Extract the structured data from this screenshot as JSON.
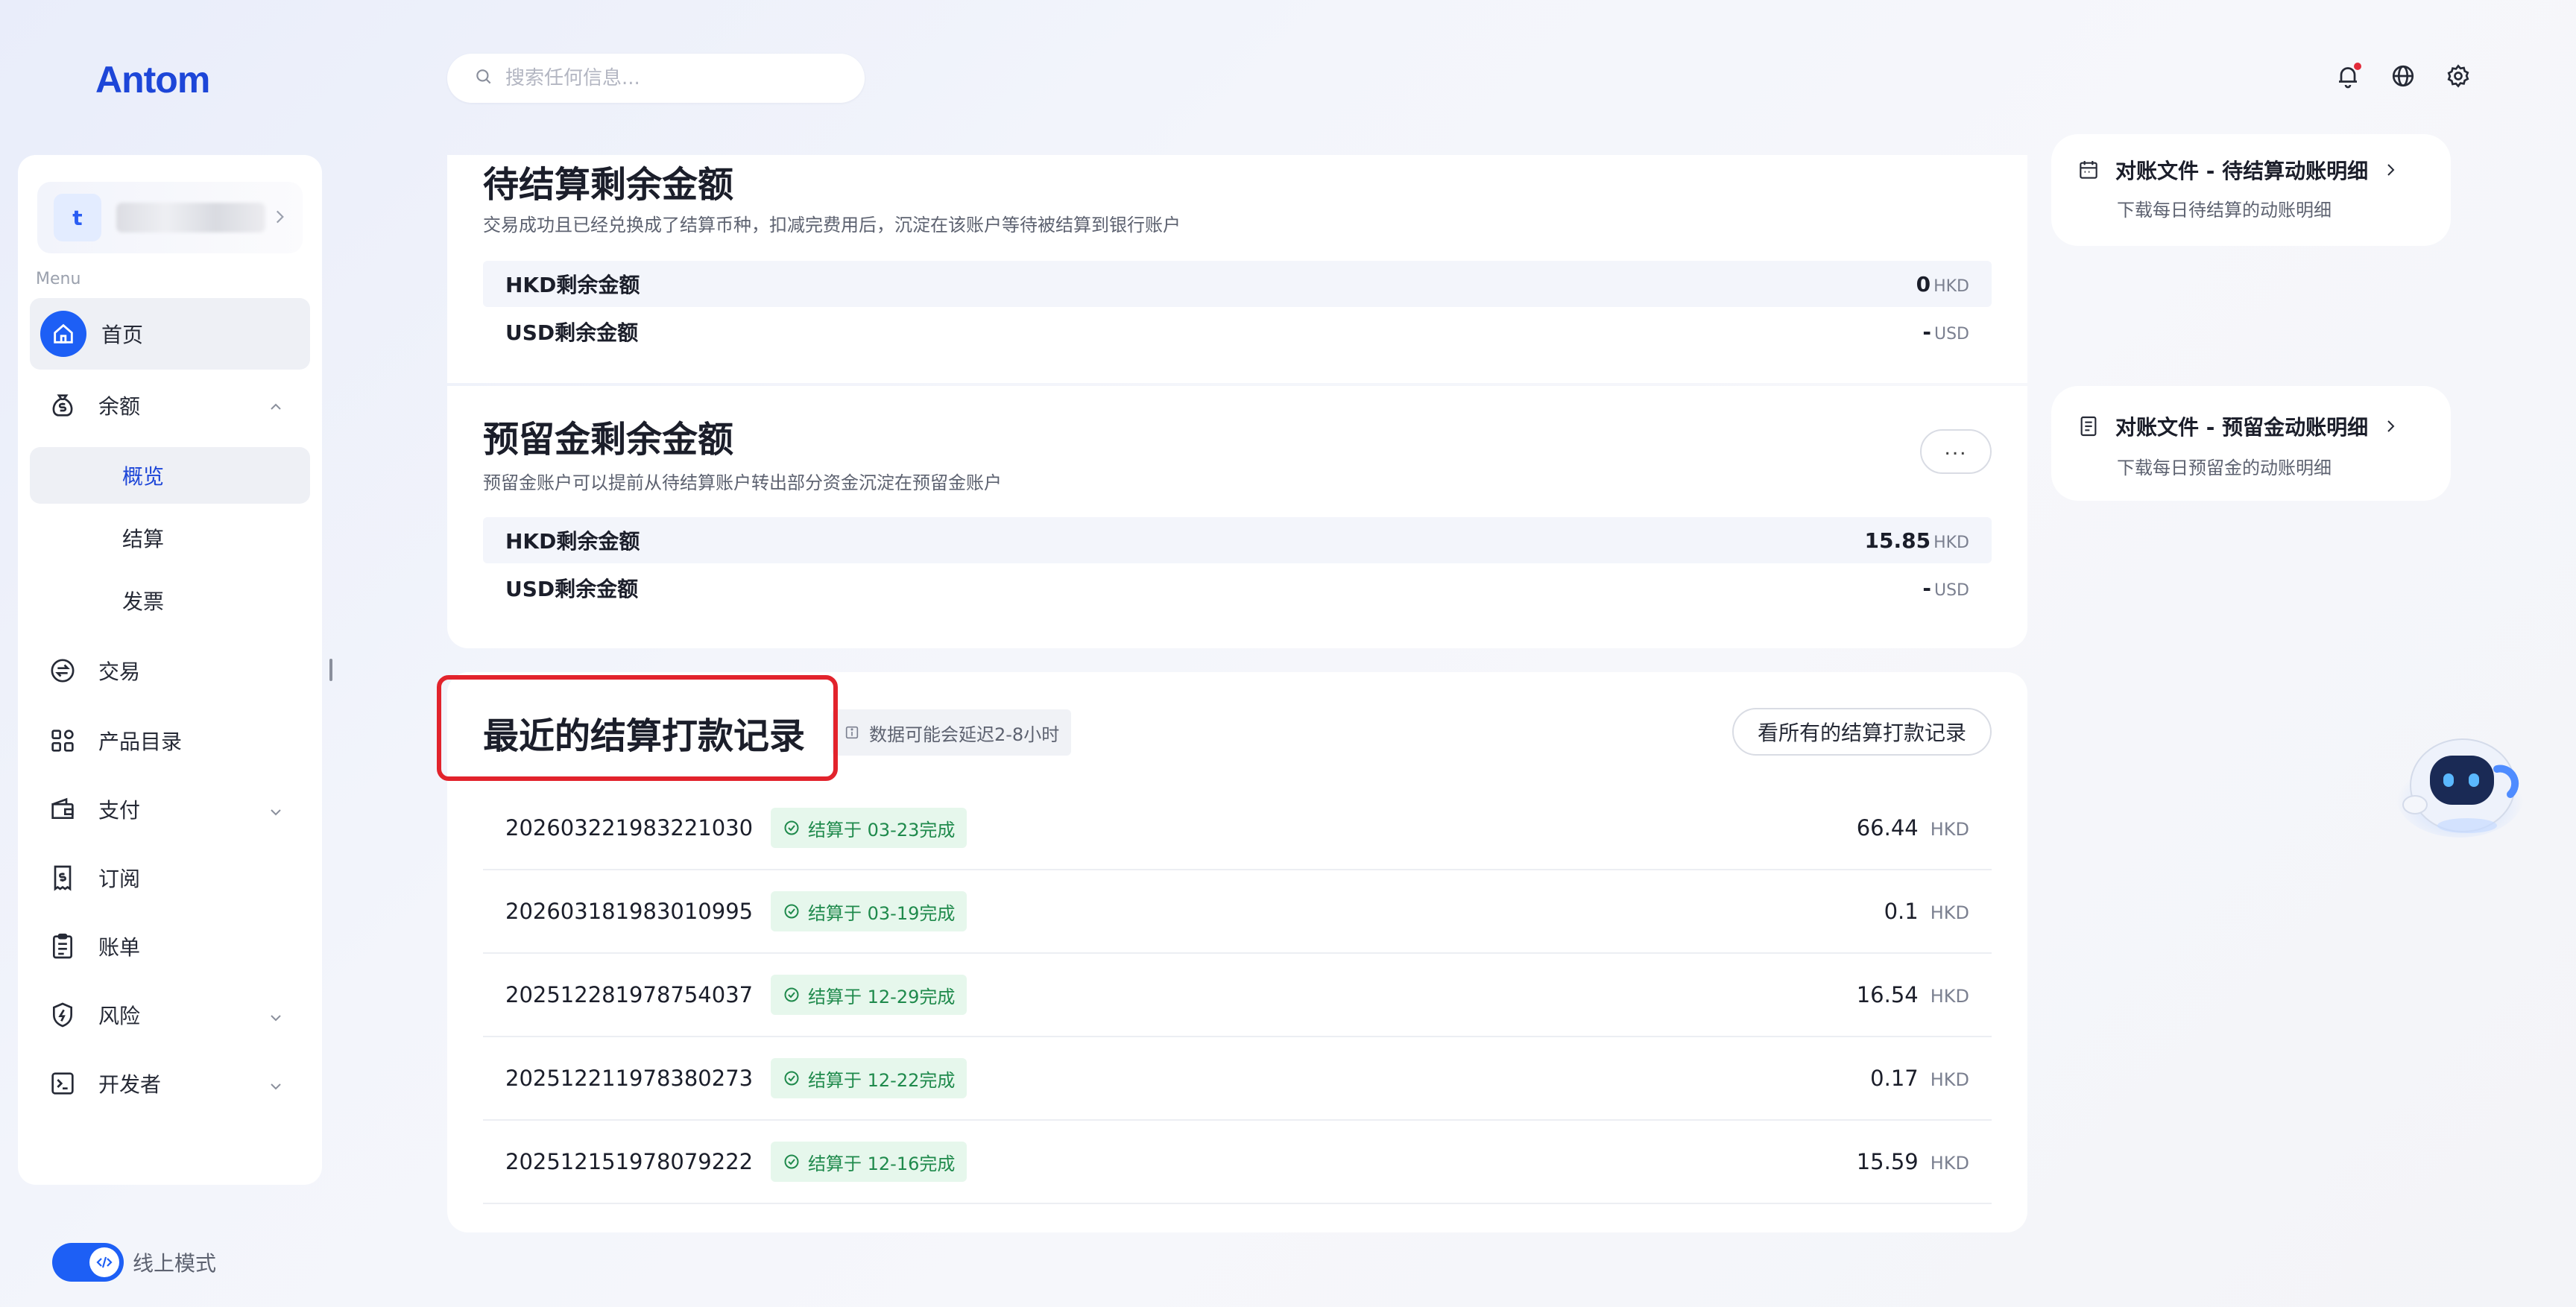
{
  "brand": {
    "logo_text": "Antom",
    "accent": "#1d5ff5",
    "highlight_color": "#e2232c"
  },
  "header": {
    "search_placeholder": "搜索任何信息...",
    "icons": [
      "bell-icon",
      "globe-icon",
      "gear-icon"
    ]
  },
  "sidebar": {
    "account_initial": "t",
    "menu_label": "Menu",
    "items": {
      "home": "首页",
      "balance": "余额",
      "overview": "概览",
      "settlement": "结算",
      "invoice": "发票",
      "transactions": "交易",
      "catalog": "产品目录",
      "payments": "支付",
      "subscriptions": "订阅",
      "bills": "账单",
      "risk": "风险",
      "developer": "开发者"
    },
    "mode_label": "线上模式"
  },
  "pending": {
    "title": "待结算剩余金额",
    "desc": "交易成功且已经兑换成了结算币种，扣减完费用后，沉淀在该账户等待被结算到银行账户",
    "rows": [
      {
        "label": "HKD剩余金额",
        "amount": "0",
        "currency": "HKD"
      },
      {
        "label": "USD剩余金额",
        "amount": "-",
        "currency": "USD"
      }
    ]
  },
  "reserve": {
    "title": "预留金剩余金额",
    "desc": "预留金账户可以提前从待结算账户转出部分资金沉淀在预留金账户",
    "more": "...",
    "rows": [
      {
        "label": "HKD剩余金额",
        "amount": "15.85",
        "currency": "HKD"
      },
      {
        "label": "USD剩余金额",
        "amount": "-",
        "currency": "USD"
      }
    ]
  },
  "recent": {
    "title": "最近的结算打款记录",
    "delay_note": "数据可能会延迟2-8小时",
    "view_all": "看所有的结算打款记录",
    "records": [
      {
        "id": "202603221983221030",
        "status": "结算于 03-23完成",
        "amount": "66.44",
        "currency": "HKD"
      },
      {
        "id": "202603181983010995",
        "status": "结算于 03-19完成",
        "amount": "0.1",
        "currency": "HKD"
      },
      {
        "id": "202512281978754037",
        "status": "结算于 12-29完成",
        "amount": "16.54",
        "currency": "HKD"
      },
      {
        "id": "202512211978380273",
        "status": "结算于 12-22完成",
        "amount": "0.17",
        "currency": "HKD"
      },
      {
        "id": "202512151978079222",
        "status": "结算于 12-16完成",
        "amount": "15.59",
        "currency": "HKD"
      }
    ]
  },
  "recon": [
    {
      "title": "对账文件 - 待结算动账明细",
      "sub": "下载每日待结算的动账明细"
    },
    {
      "title": "对账文件 - 预留金动账明细",
      "sub": "下载每日预留金的动账明细"
    }
  ]
}
